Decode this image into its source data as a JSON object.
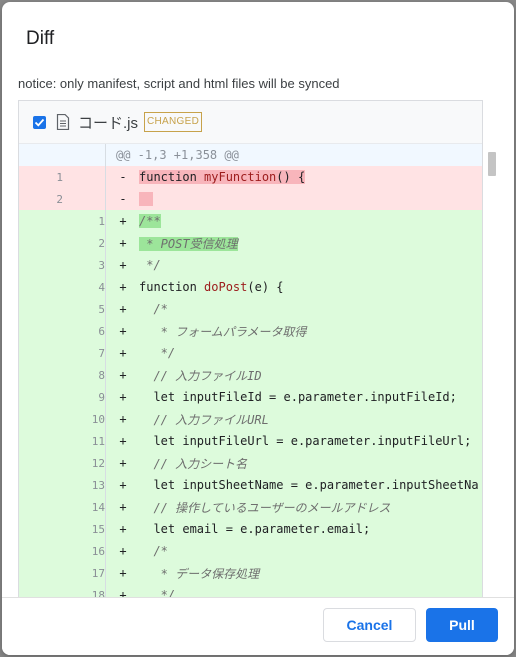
{
  "dialog": {
    "title": "Diff",
    "notice": "notice: only manifest, script and html files will be synced"
  },
  "file": {
    "checked": true,
    "name": "コード.js",
    "status": "CHANGED"
  },
  "diff": {
    "hunk": "@@ -1,3 +1,358 @@",
    "lines": [
      {
        "type": "del",
        "old": "1",
        "new": "",
        "sign": "-",
        "tokens": [
          {
            "t": "function",
            "c": "kw hl-del"
          },
          {
            "t": " ",
            "c": "hl-del"
          },
          {
            "t": "myFunction",
            "c": "fn hl-del"
          },
          {
            "t": "() {",
            "c": "hl-del"
          }
        ]
      },
      {
        "type": "del",
        "old": "2",
        "new": "",
        "sign": "-",
        "tokens": [
          {
            "t": "  ",
            "c": "hl-del"
          }
        ]
      },
      {
        "type": "add",
        "old": "",
        "new": "1",
        "sign": "+",
        "tokens": [
          {
            "t": "/**",
            "c": "cm hl-add"
          }
        ]
      },
      {
        "type": "add",
        "old": "",
        "new": "2",
        "sign": "+",
        "tokens": [
          {
            "t": " * POST受信処理",
            "c": "cm hl-add"
          }
        ]
      },
      {
        "type": "add",
        "old": "",
        "new": "3",
        "sign": "+",
        "tokens": [
          {
            "t": " */",
            "c": "cm"
          }
        ]
      },
      {
        "type": "add",
        "old": "",
        "new": "4",
        "sign": "+",
        "tokens": [
          {
            "t": "function ",
            "c": "kw"
          },
          {
            "t": "doPost",
            "c": "fn"
          },
          {
            "t": "(e) {",
            "c": ""
          }
        ]
      },
      {
        "type": "add",
        "old": "",
        "new": "5",
        "sign": "+",
        "tokens": [
          {
            "t": "  /*",
            "c": "cm"
          }
        ]
      },
      {
        "type": "add",
        "old": "",
        "new": "6",
        "sign": "+",
        "tokens": [
          {
            "t": "   * フォームパラメータ取得",
            "c": "cm"
          }
        ]
      },
      {
        "type": "add",
        "old": "",
        "new": "7",
        "sign": "+",
        "tokens": [
          {
            "t": "   */",
            "c": "cm"
          }
        ]
      },
      {
        "type": "add",
        "old": "",
        "new": "8",
        "sign": "+",
        "tokens": [
          {
            "t": "  // 入力ファイルID",
            "c": "cm"
          }
        ]
      },
      {
        "type": "add",
        "old": "",
        "new": "9",
        "sign": "+",
        "tokens": [
          {
            "t": "  let inputFileId = e.parameter.inputFileId;",
            "c": ""
          }
        ]
      },
      {
        "type": "add",
        "old": "",
        "new": "10",
        "sign": "+",
        "tokens": [
          {
            "t": "  // 入力ファイルURL",
            "c": "cm"
          }
        ]
      },
      {
        "type": "add",
        "old": "",
        "new": "11",
        "sign": "+",
        "tokens": [
          {
            "t": "  let inputFileUrl = e.parameter.inputFileUrl;",
            "c": ""
          }
        ]
      },
      {
        "type": "add",
        "old": "",
        "new": "12",
        "sign": "+",
        "tokens": [
          {
            "t": "  // 入力シート名",
            "c": "cm"
          }
        ]
      },
      {
        "type": "add",
        "old": "",
        "new": "13",
        "sign": "+",
        "tokens": [
          {
            "t": "  let inputSheetName = e.parameter.inputSheetNa",
            "c": ""
          }
        ]
      },
      {
        "type": "add",
        "old": "",
        "new": "14",
        "sign": "+",
        "tokens": [
          {
            "t": "  // 操作しているユーザーのメールアドレス",
            "c": "cm"
          }
        ]
      },
      {
        "type": "add",
        "old": "",
        "new": "15",
        "sign": "+",
        "tokens": [
          {
            "t": "  let email = e.parameter.email;",
            "c": ""
          }
        ]
      },
      {
        "type": "add",
        "old": "",
        "new": "16",
        "sign": "+",
        "tokens": [
          {
            "t": "  /*",
            "c": "cm"
          }
        ]
      },
      {
        "type": "add",
        "old": "",
        "new": "17",
        "sign": "+",
        "tokens": [
          {
            "t": "   * データ保存処理",
            "c": "cm"
          }
        ]
      },
      {
        "type": "add",
        "old": "",
        "new": "18",
        "sign": "+",
        "tokens": [
          {
            "t": "   */",
            "c": "cm"
          }
        ]
      }
    ]
  },
  "buttons": {
    "cancel": "Cancel",
    "pull": "Pull"
  },
  "colors": {
    "primary": "#1a73e8",
    "deleted_bg": "#ffe3e4",
    "added_bg": "#ddfbdc",
    "badge": "#c7a24a"
  }
}
